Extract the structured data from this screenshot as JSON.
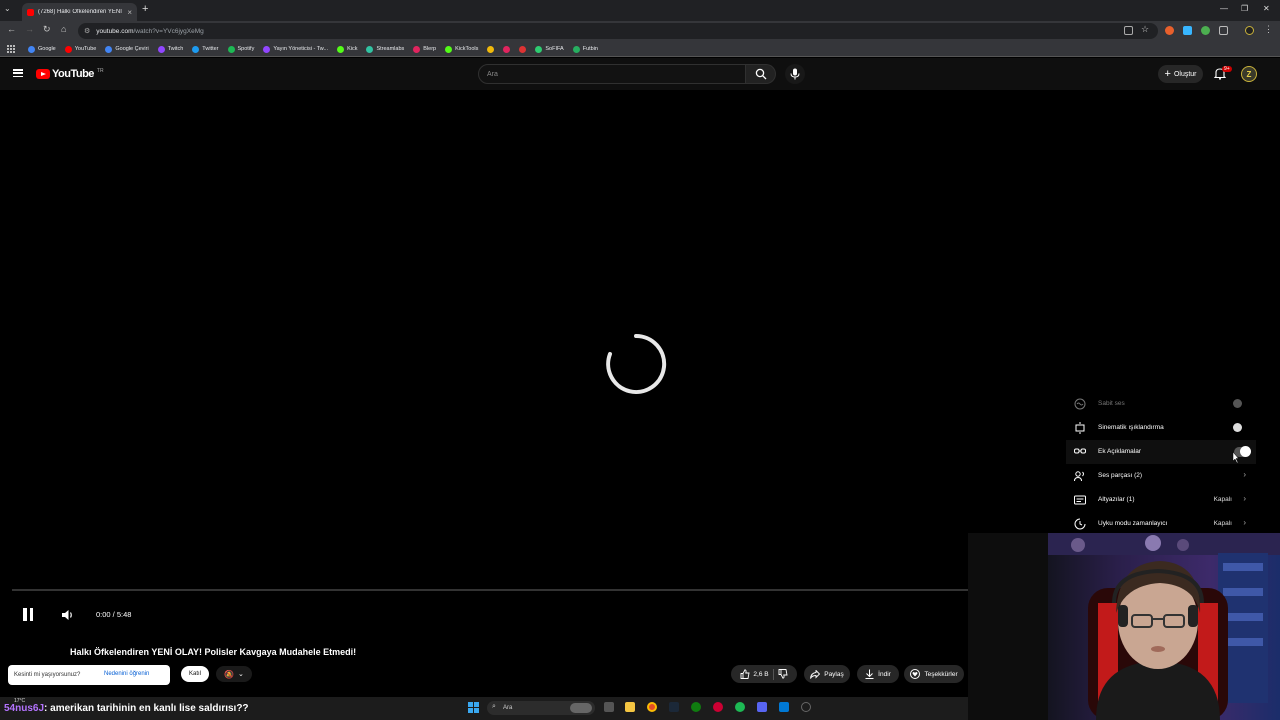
{
  "browser": {
    "tab_title": "(7268) Halkı Öfkelendiren YENİ",
    "url_host": "youtube.com",
    "url_path": "/watch?v=YVc6jygXeMg",
    "bookmarks": [
      {
        "label": "Google",
        "color": "#4285f4"
      },
      {
        "label": "YouTube",
        "color": "#ff0000"
      },
      {
        "label": "Google Çeviri",
        "color": "#4285f4"
      },
      {
        "label": "Twitch",
        "color": "#9146ff"
      },
      {
        "label": "Twitter",
        "color": "#1d9bf0"
      },
      {
        "label": "Spotify",
        "color": "#1db954"
      },
      {
        "label": "Yayın Yöneticisi - Tw...",
        "color": "#9146ff"
      },
      {
        "label": "Kick",
        "color": "#53fc18"
      },
      {
        "label": "Streamlabs",
        "color": "#31c3a2"
      },
      {
        "label": "Blerp",
        "color": "#e0245e"
      },
      {
        "label": "KickTools",
        "color": "#53fc18"
      },
      {
        "label": "",
        "color": "#f0b90b"
      },
      {
        "label": "",
        "color": "#e0245e"
      },
      {
        "label": "",
        "color": "#d33"
      },
      {
        "label": "SoFIFA",
        "color": "#2ecc71"
      },
      {
        "label": "Futbin",
        "color": "#27ae60"
      }
    ]
  },
  "youtube": {
    "logo_text": "YouTube",
    "logo_region": "TR",
    "search_placeholder": "Ara",
    "create_label": "Oluştur",
    "notif_count": "9+",
    "avatar_letter": "Z"
  },
  "player": {
    "time": "0:00 / 5:48",
    "progress": 0.0,
    "state": "loading"
  },
  "settings_menu": [
    {
      "label": "Sabit ses",
      "control": "dot",
      "enabled": false,
      "value": ""
    },
    {
      "label": "Sinematik ışıklandırma",
      "control": "dot",
      "enabled": true,
      "value": ""
    },
    {
      "label": "Ek Açıklamalar",
      "control": "toggle",
      "enabled": true,
      "value": ""
    },
    {
      "label": "Ses parçası (2)",
      "control": "chevron",
      "enabled": true,
      "value": ""
    },
    {
      "label": "Altyazılar (1)",
      "control": "chevron",
      "enabled": true,
      "value": "Kapalı"
    },
    {
      "label": "Uyku modu zamanlayıcı",
      "control": "chevron",
      "enabled": true,
      "value": "Kapalı"
    }
  ],
  "video": {
    "title": "Halkı Öfkelendiren YENİ OLAY! Polisler Kavgaya Mudahele Etmedi!",
    "poll_question": "Kesinti mi yaşıyorsunuz?",
    "poll_link": "Nedenini öğrenin",
    "join_label": "Katıl",
    "likes": "2,6 B",
    "share_label": "Paylaş",
    "download_label": "İndir",
    "thanks_label": "Teşekkürler"
  },
  "overlay": {
    "chat_user": "54nus6J",
    "chat_text": ": amerikan tarihinin en kanlı lise saldırısı??",
    "weather": "17°C"
  },
  "taskbar": {
    "search_placeholder": "Ara"
  }
}
